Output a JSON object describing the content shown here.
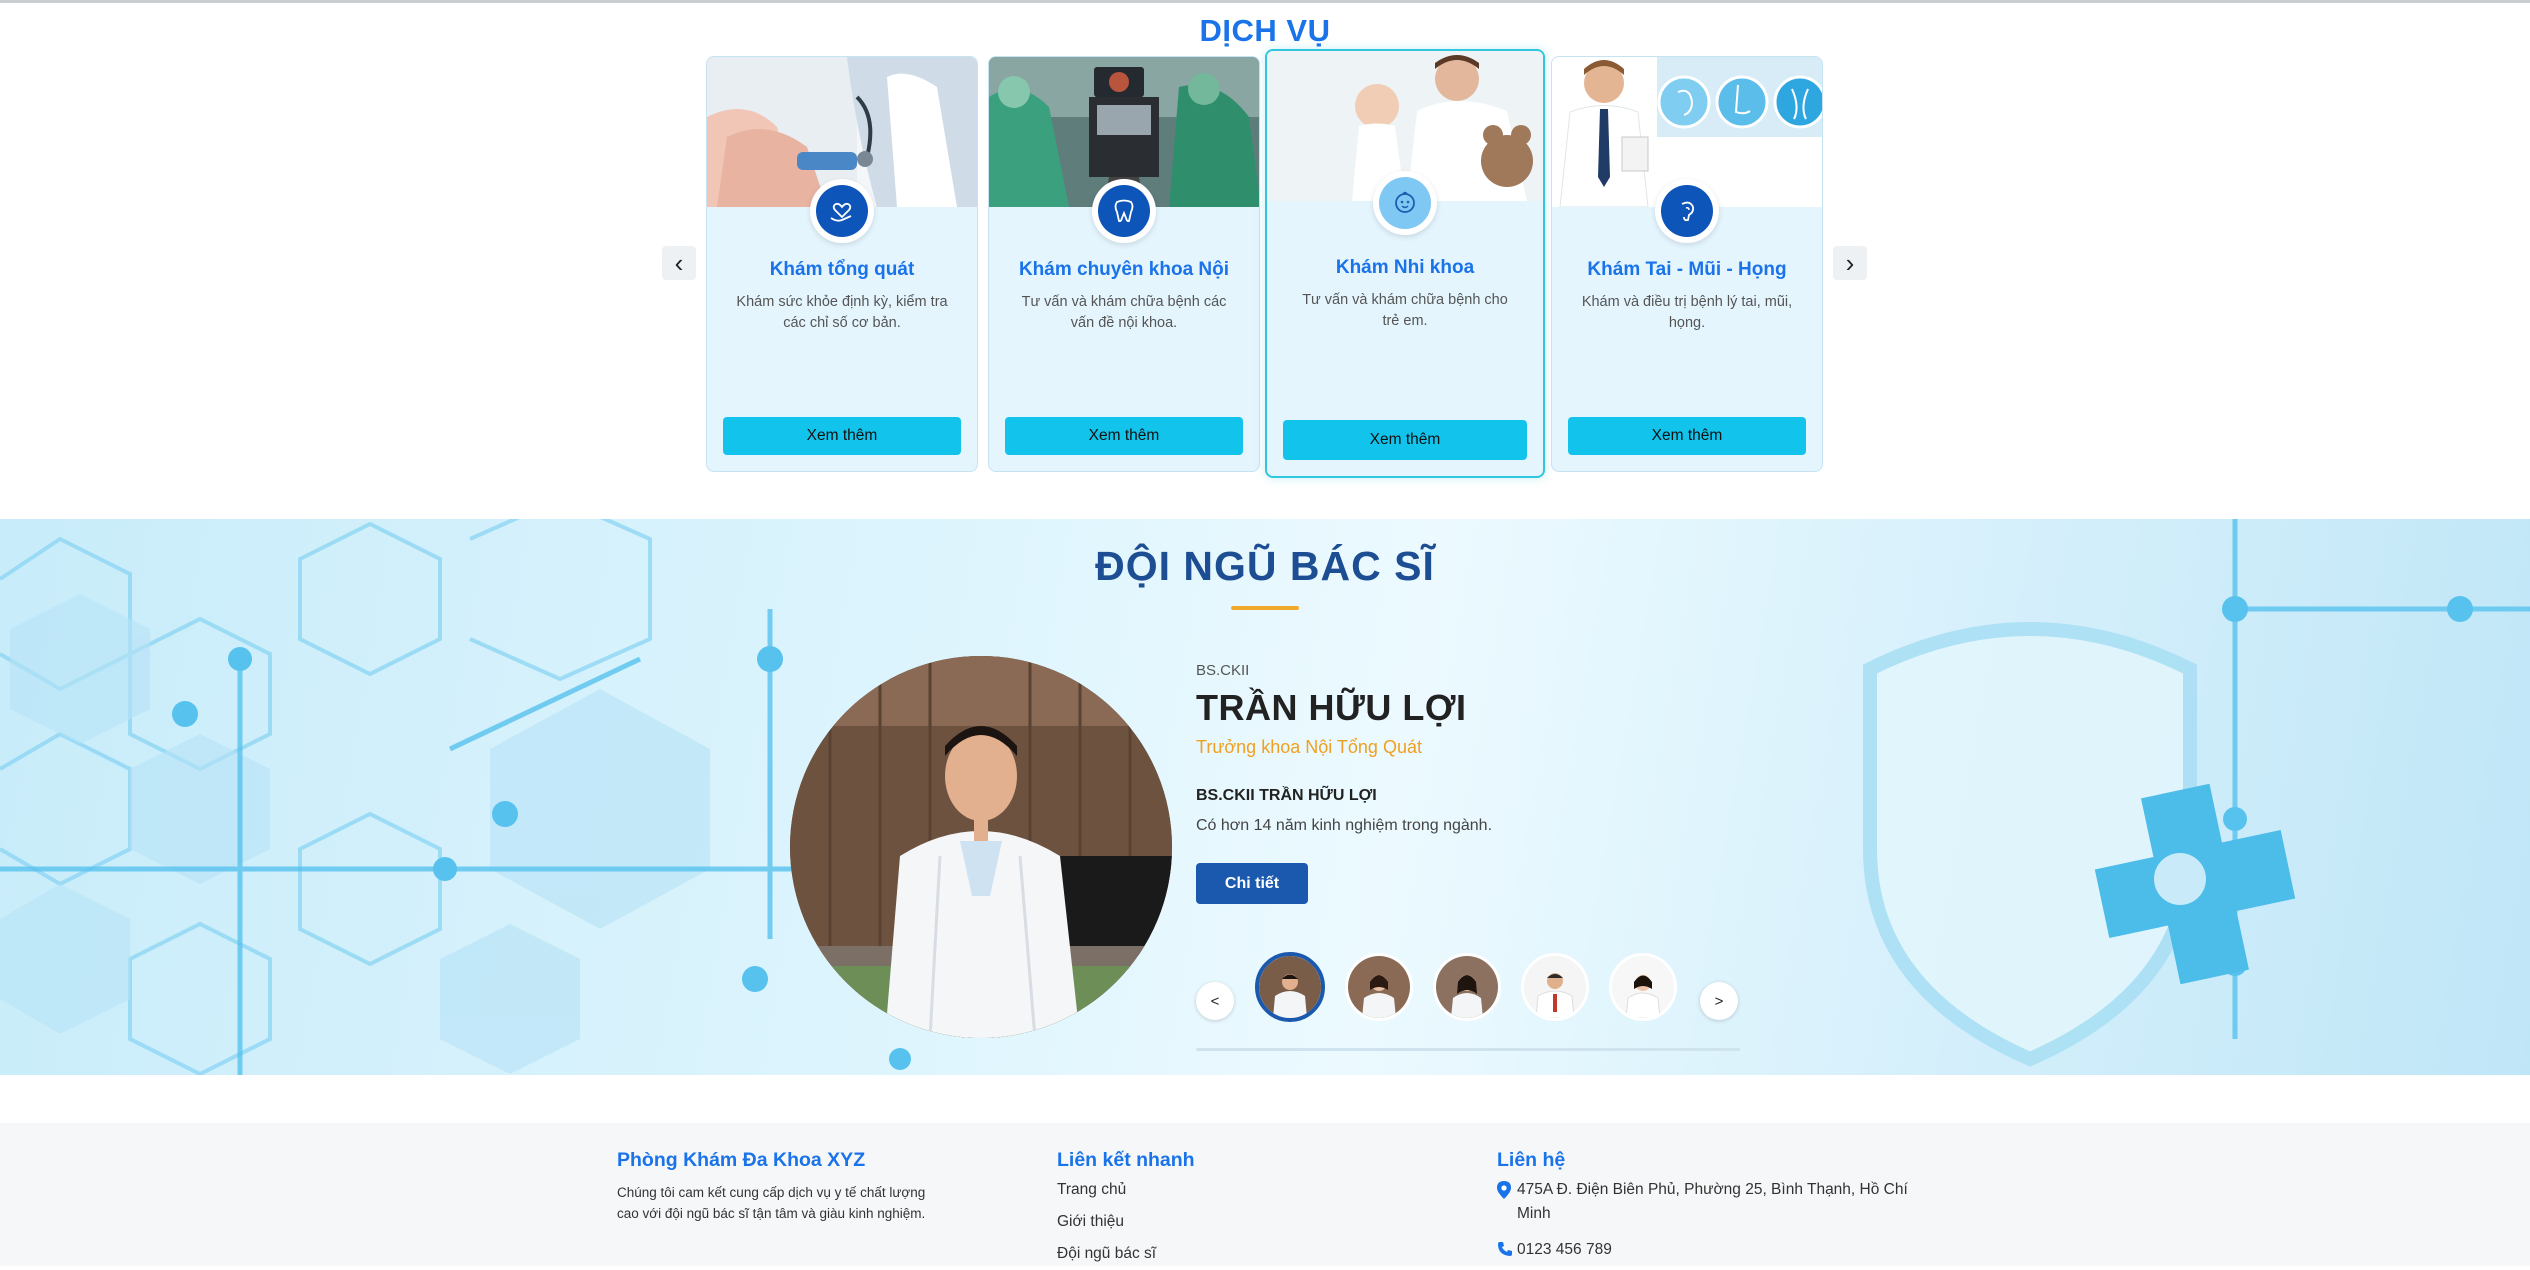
{
  "services": {
    "title": "DỊCH VỤ",
    "prev": "‹",
    "next": "›",
    "cards": [
      {
        "name": "Khám tổng quát",
        "desc": "Khám sức khỏe định kỳ, kiểm tra các chỉ số cơ bản.",
        "button": "Xem thêm",
        "icon": "heart-hand-icon"
      },
      {
        "name": "Khám chuyên khoa Nội",
        "desc": "Tư vấn và khám chữa bệnh các vấn đề nội khoa.",
        "button": "Xem thêm",
        "icon": "tooth-icon"
      },
      {
        "name": "Khám Nhi khoa",
        "desc": "Tư vấn và khám chữa bệnh cho trẻ em.",
        "button": "Xem thêm",
        "icon": "baby-icon"
      },
      {
        "name": "Khám Tai - Mũi - Họng",
        "desc": "Khám và điều trị bệnh lý tai, mũi, họng.",
        "button": "Xem thêm",
        "icon": "ent-icon"
      }
    ]
  },
  "doctors": {
    "title": "ĐỘI NGŨ BÁC SĨ",
    "degree": "BS.CKII",
    "name": "TRẦN HỮU LỢI",
    "role": "Trưởng khoa Nội Tổng Quát",
    "subtitle": "BS.CKII TRẦN HỮU LỢI",
    "experience": "Có hơn 14 năm kinh nghiệm trong ngành.",
    "button": "Chi tiết",
    "prev": "<",
    "next": ">",
    "active_index": 0
  },
  "footer": {
    "about": {
      "title": "Phòng Khám Đa Khoa XYZ",
      "text": "Chúng tôi cam kết cung cấp dịch vụ y tế chất lượng cao với đội ngũ bác sĩ tận tâm và giàu kinh nghiệm."
    },
    "links": {
      "title": "Liên kết nhanh",
      "items": [
        "Trang chủ",
        "Giới thiệu",
        "Đội ngũ bác sĩ"
      ]
    },
    "contact": {
      "title": "Liên hệ",
      "address": "475A Đ. Điện Biên Phủ, Phường 25, Bình Thạnh, Hồ Chí Minh",
      "phone": "0123 456 789"
    }
  },
  "colors": {
    "primary": "#1a73e8",
    "navy": "#1d4e94",
    "cyan_button": "#12c4ec",
    "accent_orange": "#f0a020"
  }
}
